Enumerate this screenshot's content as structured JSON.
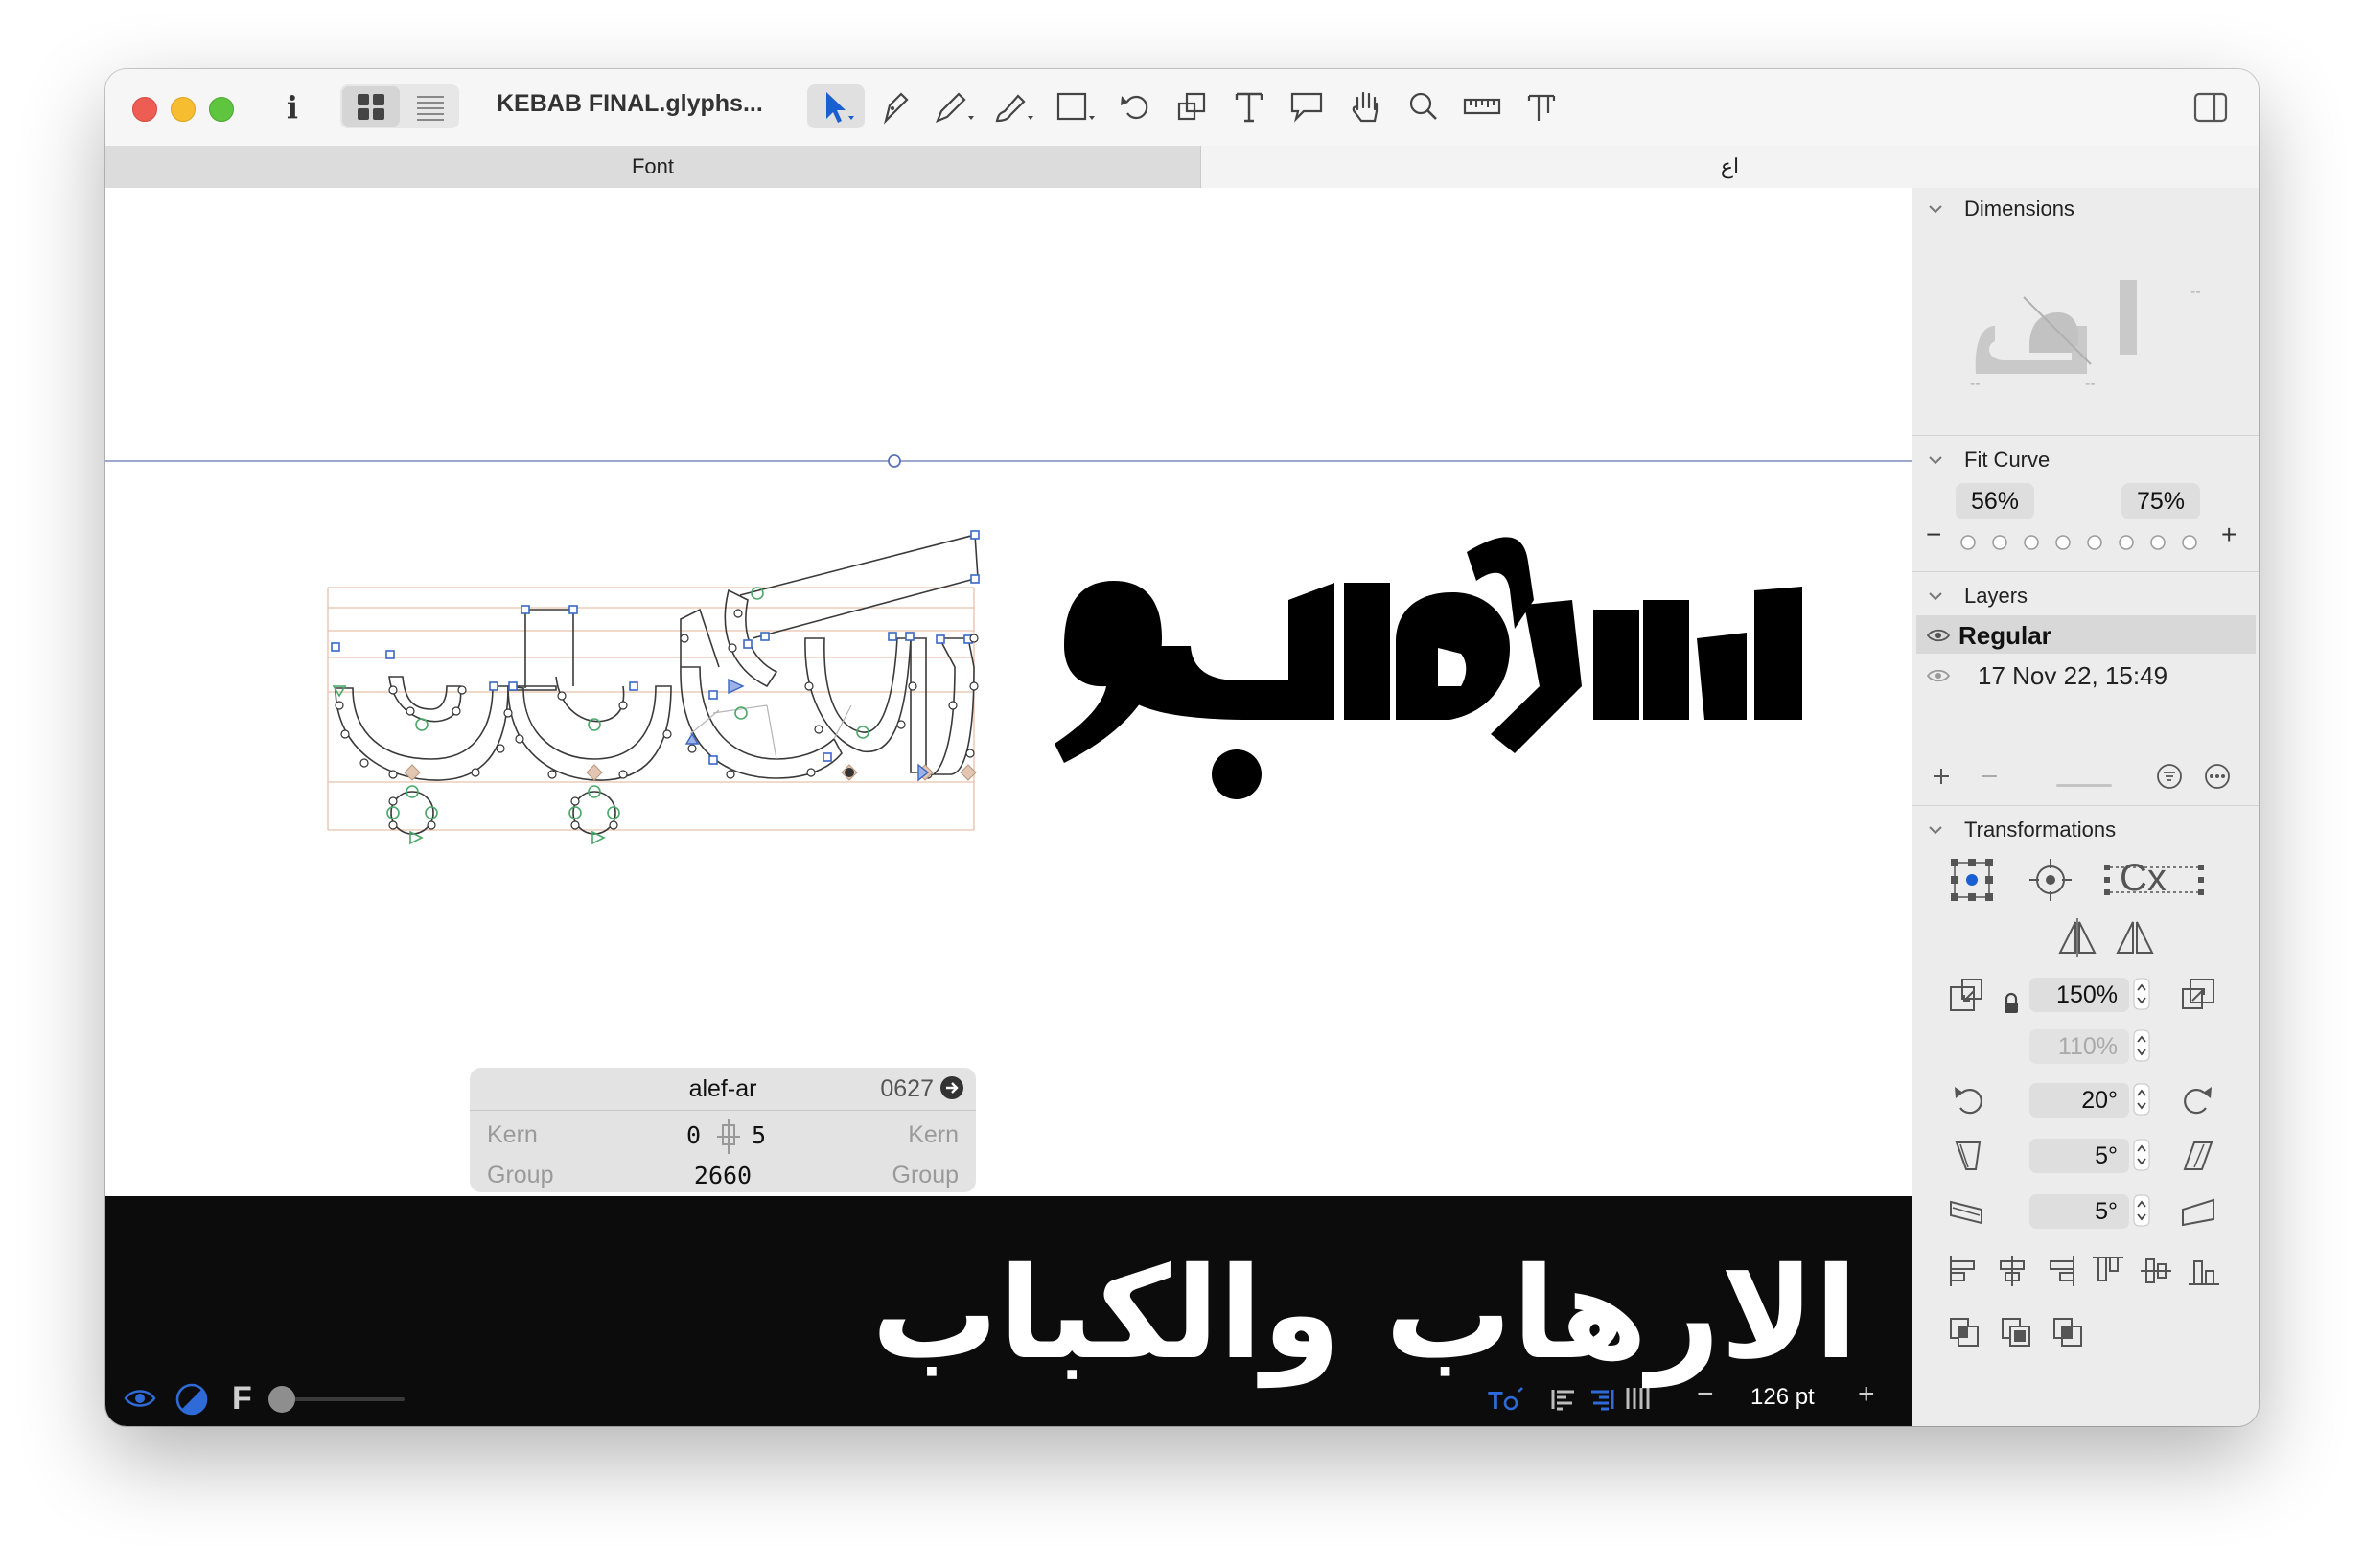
{
  "toolbar": {
    "document_title": "KEBAB FINAL.glyphs...",
    "info_label": "i",
    "tools": [
      "select-tool",
      "draw-tool",
      "pencil-tool",
      "brush-tool",
      "rectangle-tool",
      "rotate-tool",
      "scale-tool",
      "text-tool",
      "annotation-tool",
      "hand-tool",
      "zoom-tool",
      "measure-tool",
      "type-tool"
    ],
    "active_tool": "select-tool",
    "view_mode": "grid"
  },
  "tabs": [
    {
      "label": "Font",
      "active": false
    },
    {
      "label": "اع",
      "active": true
    }
  ],
  "canvas": {
    "edit_text": "الارهاب والكباب",
    "outline_color": "#333333",
    "node_color": "#3a67c4",
    "smooth_node_color": "#4aa86a",
    "metrics_line_color": "#e4b8a0",
    "baseline_guide_color": "#6b7fb4"
  },
  "glyph_info": {
    "glyph_name": "alef-ar",
    "unicode": "0627",
    "kern_left_label": "Kern",
    "kern_right_label": "Kern",
    "lsb": "0",
    "rsb": "5",
    "group_left_label": "Group",
    "group_right_label": "Group",
    "width": "2660"
  },
  "preview": {
    "text": "الارهاب والكباب",
    "background": "#0c0c0c",
    "text_color": "#ffffff"
  },
  "bottom_bar": {
    "font_label": "F",
    "slider_value": 0.0,
    "font_size": "126 pt",
    "decrease_label": "−",
    "increase_label": "+",
    "text_direction_icon": "rtl-text-icon",
    "accent": "#1a66d6"
  },
  "sidebar": {
    "dimensions": {
      "title": "Dimensions",
      "placeholder_marks": [
        "--",
        "--",
        "--"
      ]
    },
    "fit_curve": {
      "title": "Fit Curve",
      "min_value": "56%",
      "max_value": "75%",
      "minus_label": "−",
      "plus_label": "+",
      "dot_count": 8
    },
    "layers": {
      "title": "Layers",
      "items": [
        {
          "name": "Regular",
          "selected": true
        },
        {
          "name": "17 Nov 22, 15:49",
          "selected": false
        }
      ]
    },
    "transformations": {
      "title": "Transformations",
      "scale": "150%",
      "scale_secondary": "110%",
      "rotate": "20°",
      "slant": "5°",
      "skew": "5°",
      "contour_label": "Cx"
    }
  }
}
